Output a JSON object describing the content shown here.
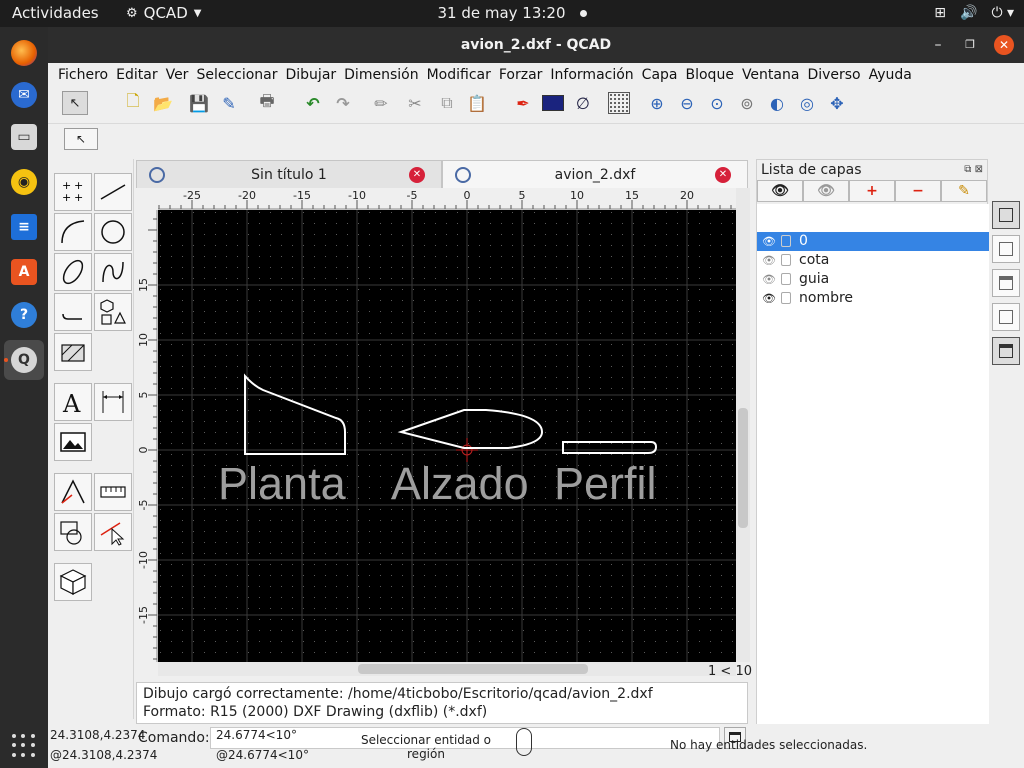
{
  "topbar": {
    "activities": "Actividades",
    "app_name": "QCAD",
    "clock": "31 de may  13:20"
  },
  "window": {
    "title": "avion_2.dxf - QCAD"
  },
  "menu": [
    "Fichero",
    "Editar",
    "Ver",
    "Seleccionar",
    "Dibujar",
    "Dimensión",
    "Modificar",
    "Forzar",
    "Información",
    "Capa",
    "Bloque",
    "Ventana",
    "Diverso",
    "Ayuda"
  ],
  "tabs": [
    {
      "label": "Sin título 1"
    },
    {
      "label": "avion_2.dxf"
    }
  ],
  "rulers": {
    "h_ticks": [
      "-25",
      "-20",
      "-15",
      "-10",
      "-5",
      "0",
      "5",
      "10",
      "15",
      "20"
    ],
    "v_ticks": [
      "15",
      "10",
      "5",
      "0",
      "-5",
      "-10",
      "-15"
    ]
  },
  "drawing": {
    "labels": [
      "Planta",
      "Alzado",
      "Perfil"
    ]
  },
  "page_info": "1 < 10",
  "history": {
    "line1": "Dibujo cargó correctamente: /home/4ticbobo/Escritorio/qcad/avion_2.dxf",
    "line2": "Formato: R15 (2000) DXF Drawing (dxflib) (*.dxf)"
  },
  "command": {
    "label": "Comando:",
    "value": ""
  },
  "status": {
    "abs_coord": "24.3108,4.2374",
    "rel_coord": "@24.3108,4.2374",
    "polar_coord": "24.6774<10°",
    "rel_polar": "@24.6774<10°",
    "mouse_hint_1": "Seleccionar entidad o",
    "mouse_hint_2": "región",
    "selection": "No hay entidades seleccionadas."
  },
  "layers": {
    "title": "Lista de capas",
    "items": [
      {
        "name": "0",
        "selected": true
      },
      {
        "name": "cota",
        "selected": false
      },
      {
        "name": "guia",
        "selected": false
      },
      {
        "name": "nombre",
        "selected": false
      }
    ]
  },
  "colors": {
    "accent": "#e95420",
    "selection": "#3584e4",
    "canvas": "#000000"
  }
}
